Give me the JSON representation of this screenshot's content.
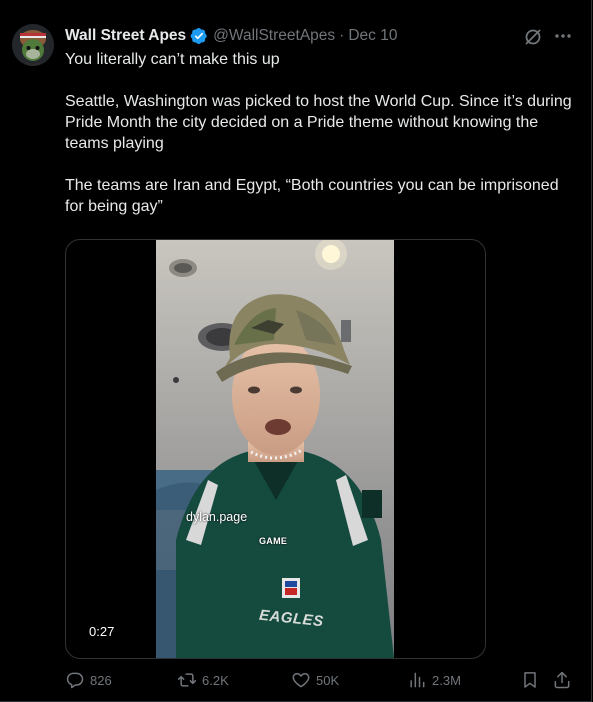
{
  "tweet": {
    "author_name": "Wall Street Apes",
    "handle": "@WallStreetApes",
    "separator": "·",
    "date": "Dec 10",
    "paragraphs": [
      "You literally can’t make this up",
      "Seattle, Washington was picked to host the World Cup. Since it’s during Pride Month the city decided on a Pride theme without knowing the teams playing",
      "The teams are Iran and Egypt, “Both countries you can be imprisoned for being gay”"
    ]
  },
  "video": {
    "duration": "0:27",
    "overlay_username": "dylan.page",
    "overlay_word": "GAME",
    "jersey_text": "EAGLES"
  },
  "actions": {
    "replies": "826",
    "reposts": "6.2K",
    "likes": "50K",
    "views": "2.3M"
  },
  "colors": {
    "background": "#000000",
    "text": "#e7e9ea",
    "muted": "#71767b",
    "verified": "#1d9bf0",
    "border": "#2f3336"
  }
}
